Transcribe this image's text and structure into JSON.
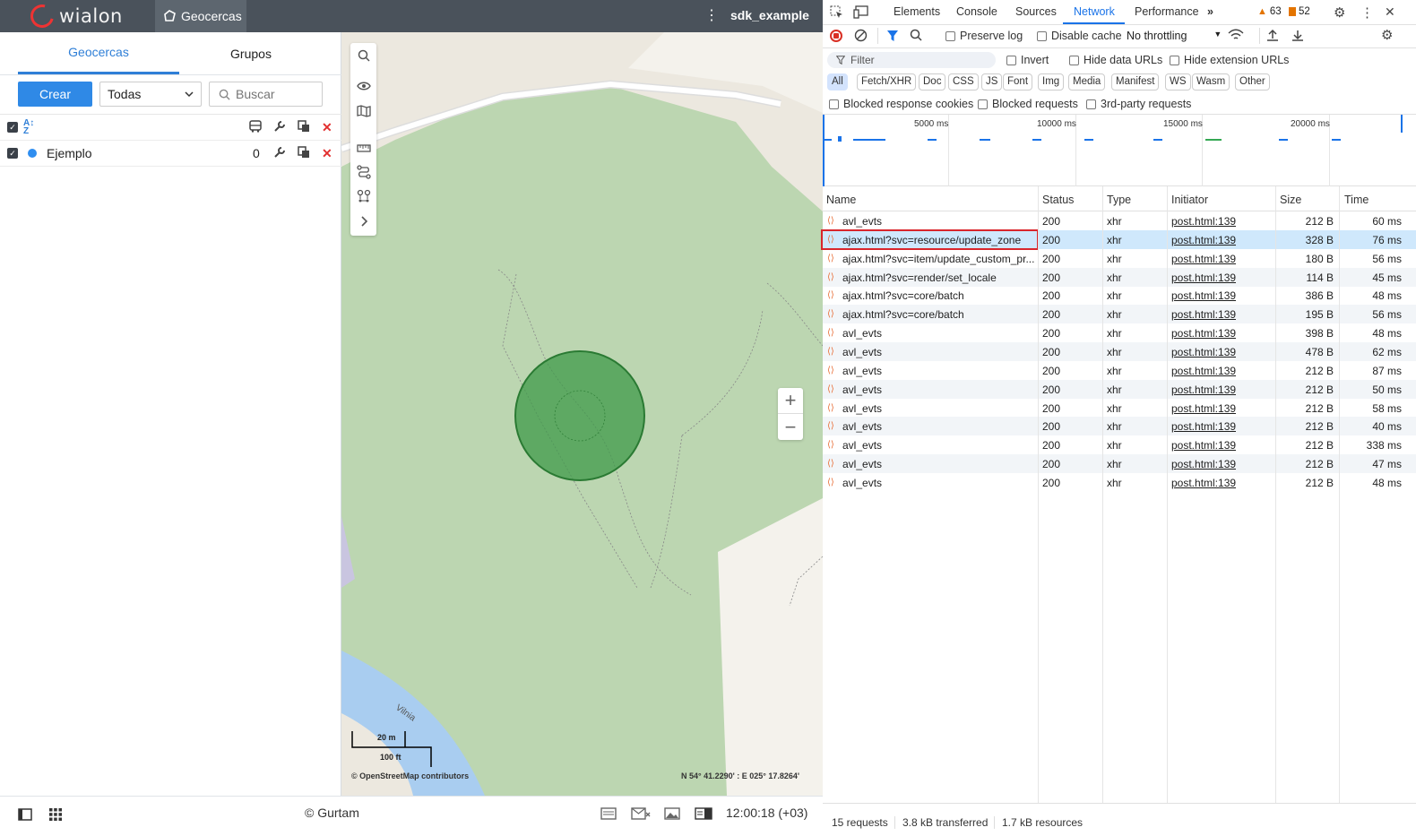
{
  "app": {
    "brand": "wialon",
    "active_module": "Geocercas",
    "user": "sdk_example",
    "tabs": [
      "Geocercas",
      "Grupos"
    ],
    "create_label": "Crear",
    "filter_value": "Todas",
    "search_placeholder": "Buscar",
    "items": [
      {
        "name": "Ejemplo",
        "count": "0",
        "color": "#2f8ef0"
      }
    ],
    "map": {
      "attribution": "© OpenStreetMap contributors",
      "coords": "N 54° 41.2290' : E 025° 17.8264'",
      "scale_metric": "20 m",
      "scale_imperial": "100 ft",
      "river_label": "Vilnia"
    },
    "footer": {
      "copyright": "© Gurtam",
      "time": "12:00:18 (+03)"
    }
  },
  "devtools": {
    "tabs": [
      "Elements",
      "Console",
      "Sources",
      "Network",
      "Performance"
    ],
    "active_tab": "Network",
    "warnings": "63",
    "issues": "52",
    "preserve_log": "Preserve log",
    "disable_cache": "Disable cache",
    "throttling": "No throttling",
    "filter_placeholder": "Filter",
    "invert": "Invert",
    "hide_data_urls": "Hide data URLs",
    "hide_ext_urls": "Hide extension URLs",
    "type_filters": [
      "All",
      "Fetch/XHR",
      "Doc",
      "CSS",
      "JS",
      "Font",
      "Img",
      "Media",
      "Manifest",
      "WS",
      "Wasm",
      "Other"
    ],
    "blocked_cookies": "Blocked response cookies",
    "blocked_requests": "Blocked requests",
    "third_party": "3rd-party requests",
    "timeline_labels": [
      "5000 ms",
      "10000 ms",
      "15000 ms",
      "20000 ms"
    ],
    "columns": [
      "Name",
      "Status",
      "Type",
      "Initiator",
      "Size",
      "Time"
    ],
    "requests": [
      {
        "name": "avl_evts",
        "status": "200",
        "type": "xhr",
        "initiator": "post.html:139",
        "size": "212 B",
        "time": "60 ms"
      },
      {
        "name": "ajax.html?svc=resource/update_zone",
        "status": "200",
        "type": "xhr",
        "initiator": "post.html:139",
        "size": "328 B",
        "time": "76 ms"
      },
      {
        "name": "ajax.html?svc=item/update_custom_pr...",
        "status": "200",
        "type": "xhr",
        "initiator": "post.html:139",
        "size": "180 B",
        "time": "56 ms"
      },
      {
        "name": "ajax.html?svc=render/set_locale",
        "status": "200",
        "type": "xhr",
        "initiator": "post.html:139",
        "size": "114 B",
        "time": "45 ms"
      },
      {
        "name": "ajax.html?svc=core/batch",
        "status": "200",
        "type": "xhr",
        "initiator": "post.html:139",
        "size": "386 B",
        "time": "48 ms"
      },
      {
        "name": "ajax.html?svc=core/batch",
        "status": "200",
        "type": "xhr",
        "initiator": "post.html:139",
        "size": "195 B",
        "time": "56 ms"
      },
      {
        "name": "avl_evts",
        "status": "200",
        "type": "xhr",
        "initiator": "post.html:139",
        "size": "398 B",
        "time": "48 ms"
      },
      {
        "name": "avl_evts",
        "status": "200",
        "type": "xhr",
        "initiator": "post.html:139",
        "size": "478 B",
        "time": "62 ms"
      },
      {
        "name": "avl_evts",
        "status": "200",
        "type": "xhr",
        "initiator": "post.html:139",
        "size": "212 B",
        "time": "87 ms"
      },
      {
        "name": "avl_evts",
        "status": "200",
        "type": "xhr",
        "initiator": "post.html:139",
        "size": "212 B",
        "time": "50 ms"
      },
      {
        "name": "avl_evts",
        "status": "200",
        "type": "xhr",
        "initiator": "post.html:139",
        "size": "212 B",
        "time": "58 ms"
      },
      {
        "name": "avl_evts",
        "status": "200",
        "type": "xhr",
        "initiator": "post.html:139",
        "size": "212 B",
        "time": "40 ms"
      },
      {
        "name": "avl_evts",
        "status": "200",
        "type": "xhr",
        "initiator": "post.html:139",
        "size": "212 B",
        "time": "338 ms"
      },
      {
        "name": "avl_evts",
        "status": "200",
        "type": "xhr",
        "initiator": "post.html:139",
        "size": "212 B",
        "time": "47 ms"
      },
      {
        "name": "avl_evts",
        "status": "200",
        "type": "xhr",
        "initiator": "post.html:139",
        "size": "212 B",
        "time": "48 ms"
      }
    ],
    "selected_request_index": 1,
    "summary": {
      "requests": "15 requests",
      "transferred": "3.8 kB transferred",
      "resources": "1.7 kB resources"
    }
  }
}
